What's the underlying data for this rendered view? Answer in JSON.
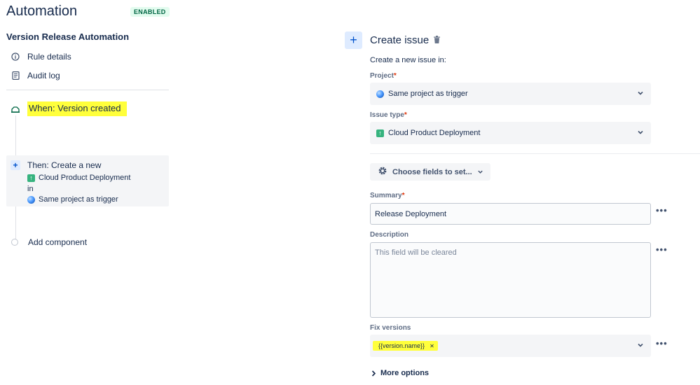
{
  "header": {
    "title": "Automation",
    "status": "ENABLED"
  },
  "rule": {
    "name": "Version Release Automation"
  },
  "nav": {
    "rule_details": "Rule details",
    "audit_log": "Audit log"
  },
  "trigger": {
    "label": "When: Version created"
  },
  "action": {
    "title": "Then: Create a new",
    "issue_type": "Cloud Product Deployment",
    "in_label": "in",
    "project": "Same project as trigger"
  },
  "add_component": "Add component",
  "panel": {
    "title": "Create issue",
    "subtitle": "Create a new issue in:",
    "project_label": "Project",
    "project_value": "Same project as trigger",
    "issue_type_label": "Issue type",
    "issue_type_value": "Cloud Product Deployment",
    "choose_fields": "Choose fields to set...",
    "summary_label": "Summary",
    "summary_value": "Release Deployment",
    "description_label": "Description",
    "description_placeholder": "This field will be cleared",
    "fix_versions_label": "Fix versions",
    "fix_versions_tag": "{{version.name}}",
    "more_options": "More options",
    "required_mark": "*"
  },
  "colors": {
    "accent": "#0052cc",
    "highlight": "#ffff3b",
    "enabled": "#006644"
  }
}
